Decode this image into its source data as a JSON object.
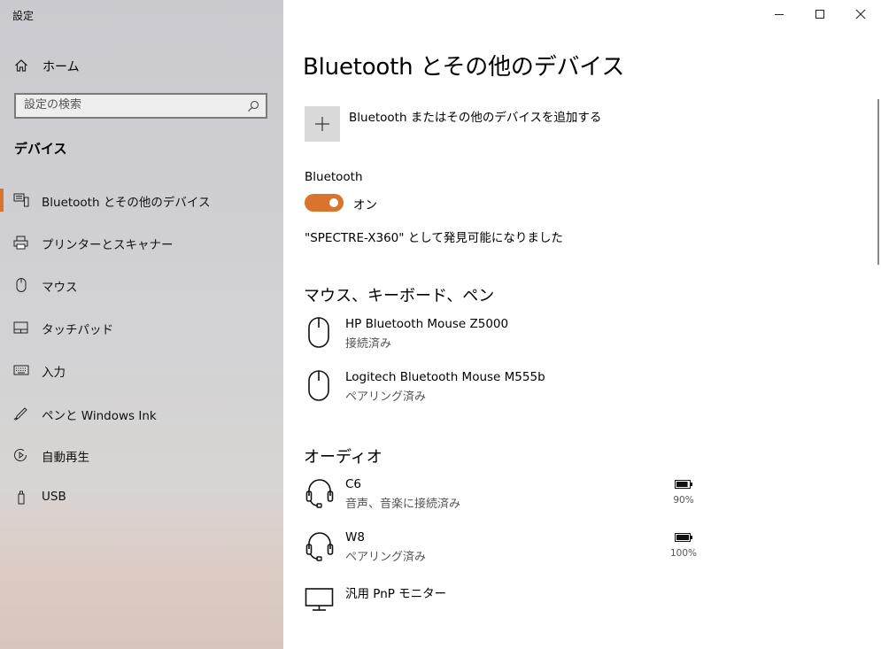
{
  "window": {
    "app_title": "設定"
  },
  "sidebar": {
    "home_label": "ホーム",
    "search_placeholder": "設定の検索",
    "section_title": "デバイス",
    "items": [
      {
        "label": "Bluetooth とその他のデバイス",
        "icon": "bluetooth-devices-icon",
        "active": true
      },
      {
        "label": "プリンターとスキャナー",
        "icon": "printer-icon",
        "active": false
      },
      {
        "label": "マウス",
        "icon": "mouse-icon",
        "active": false
      },
      {
        "label": "タッチパッド",
        "icon": "touchpad-icon",
        "active": false
      },
      {
        "label": "入力",
        "icon": "keyboard-icon",
        "active": false
      },
      {
        "label": "ペンと Windows Ink",
        "icon": "pen-icon",
        "active": false
      },
      {
        "label": "自動再生",
        "icon": "autoplay-icon",
        "active": false
      },
      {
        "label": "USB",
        "icon": "usb-icon",
        "active": false
      }
    ]
  },
  "main": {
    "title": "Bluetooth とその他のデバイス",
    "add_device_label": "Bluetooth またはその他のデバイスを追加する",
    "bluetooth_label": "Bluetooth",
    "toggle_state": "オン",
    "discoverable_text": "\"SPECTRE-X360\" として発見可能になりました",
    "groups": [
      {
        "title": "マウス、キーボード、ペン",
        "devices": [
          {
            "name": "HP Bluetooth Mouse Z5000",
            "status": "接続済み",
            "icon": "mouse-icon"
          },
          {
            "name": "Logitech Bluetooth Mouse M555b",
            "status": "ペアリング済み",
            "icon": "mouse-icon"
          }
        ]
      },
      {
        "title": "オーディオ",
        "devices": [
          {
            "name": "C6",
            "status": "音声、音楽に接続済み",
            "icon": "headset-icon",
            "battery": "90%",
            "battery_level": 0.9
          },
          {
            "name": "W8",
            "status": "ペアリング済み",
            "icon": "headset-icon",
            "battery": "100%",
            "battery_level": 1.0
          },
          {
            "name": "汎用 PnP モニター",
            "status": "",
            "icon": "monitor-icon"
          }
        ]
      }
    ]
  },
  "colors": {
    "accent": "#d9732e",
    "tile": "#d9d9d9"
  }
}
